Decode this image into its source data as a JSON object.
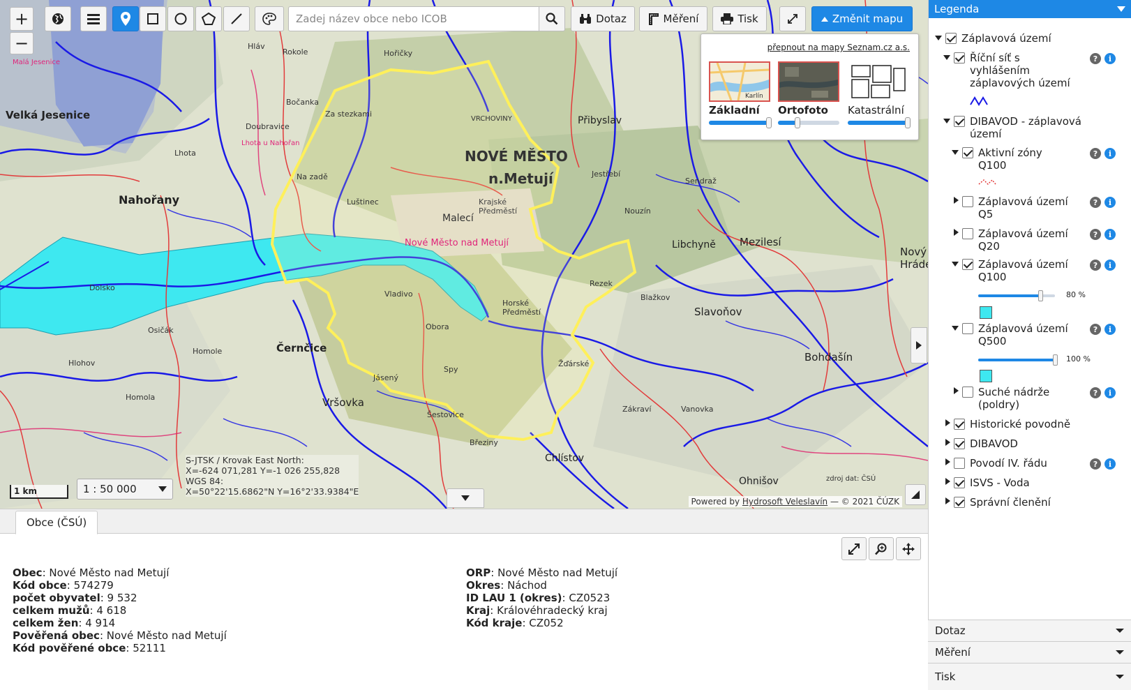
{
  "toolbar": {
    "zoom_in": "+",
    "zoom_out": "−",
    "search_placeholder": "Zadej název obce nebo ICOB",
    "dotaz": "Dotaz",
    "mereni": "Měření",
    "tisk": "Tisk",
    "zmenit_mapu": "Změnit mapu"
  },
  "basemaps": {
    "switch_link": "přepnout na mapy Seznam.cz a.s.",
    "items": [
      {
        "name": "Základní",
        "opacity": 1.0,
        "selected": true
      },
      {
        "name": "Ortofoto",
        "opacity": 0.3,
        "selected": true
      },
      {
        "name": "Katastrální",
        "opacity": 1.0,
        "selected": false
      }
    ],
    "thumb_label": "Karlín"
  },
  "map_labels": [
    "Velká Jesenice",
    "Nahořany",
    "Za stezkami",
    "VRCHOVINY",
    "NOVÉ MĚSTO",
    "n.Metují",
    "Krajské Předměstí",
    "Malecí",
    "Luštinec",
    "Na zadě",
    "Nové Město nad Metují",
    "Přibyslav",
    "Mezilesí",
    "Libchyně",
    "Slavoňov",
    "Bohdašín",
    "Černčice",
    "Vršovka",
    "Chlístov",
    "Ohnišov",
    "Dolsko",
    "Nový Hrádek",
    "Doubravice",
    "Lhota",
    "Spy",
    "Osičák",
    "Hlohov",
    "Homole",
    "Šestovice",
    "Březiny",
    "Zákraví",
    "Vanovka",
    "Jestřebí",
    "Nouzín",
    "Sendraž",
    "Blažkov",
    "Rezek",
    "Horské Předměstí",
    "Jásený",
    "Obora",
    "Vladivo",
    "Žďárské",
    "Bočanka",
    "Homola",
    "Lhota u Nahořan",
    "Malá Jesenice",
    "Rokole",
    "Hláv",
    "Hořičky"
  ],
  "coords": {
    "line1": "S-JTSK / Krovak East North:",
    "line2": "X=-624 071,281 Y=-1 026 255,828",
    "line3": "WGS 84:",
    "line4": "X=50°22'15.6862\"N Y=16°2'33.9384\"E"
  },
  "scale": {
    "bar_label": "1 km",
    "value": "1 : 50 000"
  },
  "attribution": {
    "prefix": "Powered by ",
    "link": "Hydrosoft Veleslavín",
    "suffix": " — © 2021 ČÚZK",
    "data_note": "zdroj dat: ČSÚ"
  },
  "panel": {
    "tab": "Obce (ČSÚ)",
    "left": [
      {
        "label": "Obec",
        "value": "Nové Město nad Metují"
      },
      {
        "label": "Kód obce",
        "value": "574279"
      },
      {
        "label": "počet obyvatel",
        "value": "9 532"
      },
      {
        "label": "celkem mužů",
        "value": "4 618"
      },
      {
        "label": "celkem žen",
        "value": "4 914"
      },
      {
        "label": "Pověřená obec",
        "value": "Nové Město nad Metují"
      },
      {
        "label": "Kód pověřené obce",
        "value": "52111"
      }
    ],
    "right": [
      {
        "label": "ORP",
        "value": "Nové Město nad Metují"
      },
      {
        "label": "Okres",
        "value": "Náchod"
      },
      {
        "label": "ID LAU 1 (okres)",
        "value": "CZ0523"
      },
      {
        "label": "Kraj",
        "value": "Královéhradecký kraj"
      },
      {
        "label": "Kód kraje",
        "value": "CZ052"
      }
    ]
  },
  "legend": {
    "title": "Legenda",
    "items": [
      {
        "label": "Záplavová území",
        "checked": true,
        "expanded": true
      },
      {
        "label": "Říční síť s vyhlášením záplavových území",
        "checked": true,
        "expanded": true
      },
      {
        "label": "DIBAVOD - záplavová území",
        "checked": true,
        "expanded": true
      },
      {
        "label": "Aktivní zóny Q100",
        "checked": true,
        "expanded": true
      },
      {
        "label": "Záplavová území Q5",
        "checked": false,
        "expanded": false
      },
      {
        "label": "Záplavová území Q20",
        "checked": false,
        "expanded": false
      },
      {
        "label": "Záplavová území Q100",
        "checked": true,
        "expanded": true,
        "opacity_label": "80 %",
        "opacity": 0.8
      },
      {
        "label": "Záplavová území Q500",
        "checked": false,
        "expanded": true,
        "opacity_label": "100 %",
        "opacity": 1.0
      },
      {
        "label": "Suché nádrže (poldry)",
        "checked": false,
        "expanded": false
      },
      {
        "label": "Historické povodně",
        "checked": true,
        "expanded": false
      },
      {
        "label": "DIBAVOD",
        "checked": true,
        "expanded": false
      },
      {
        "label": "Povodí IV. řádu",
        "checked": false,
        "expanded": false
      },
      {
        "label": "ISVS - Voda",
        "checked": true,
        "expanded": false
      },
      {
        "label": "Správní členění",
        "checked": true,
        "expanded": false
      }
    ],
    "colors": {
      "river": "#1a1ae6",
      "flood": "#3ee8f0",
      "active_zone": "#e23b3b",
      "accent": "#1e88e5"
    }
  },
  "accordion": [
    "Dotaz",
    "Měření",
    "Tisk"
  ]
}
